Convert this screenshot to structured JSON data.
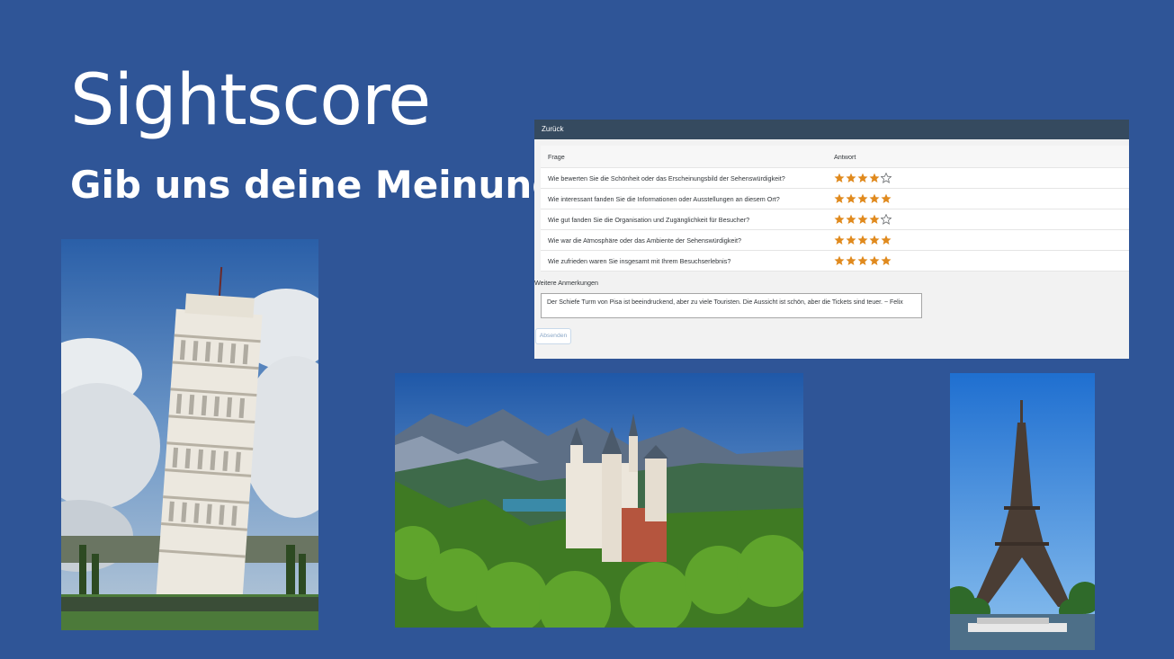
{
  "slide": {
    "title": "Sightscore",
    "subtitle": "Gib uns deine Meinung!"
  },
  "survey": {
    "back_label": "Zurück",
    "columns": {
      "question": "Frage",
      "answer": "Antwort"
    },
    "star_color": "#e08a1e",
    "max_stars": 5,
    "rows": [
      {
        "question": "Wie bewerten Sie die Schönheit oder das Erscheinungsbild der Sehenswürdigkeit?",
        "rating": 4
      },
      {
        "question": "Wie interessant fanden Sie die Informationen oder Ausstellungen an diesem Ort?",
        "rating": 5
      },
      {
        "question": "Wie gut fanden Sie die Organisation und Zugänglichkeit für Besucher?",
        "rating": 4
      },
      {
        "question": "Wie war die Atmosphäre oder das Ambiente der Sehenswürdigkeit?",
        "rating": 5
      },
      {
        "question": "Wie zufrieden waren Sie insgesamt mit Ihrem Besuchserlebnis?",
        "rating": 5
      }
    ],
    "remarks_label": "Weitere Anmerkungen",
    "remarks_value": "Der Schiefe Turm von Pisa ist beeindruckend, aber zu viele Touristen. Die Aussicht ist schön, aber die Tickets sind teuer. ~ Felix",
    "submit_label": "Absenden"
  },
  "photos": [
    {
      "name": "leaning-tower-of-pisa-photo"
    },
    {
      "name": "neuschwanstein-castle-photo"
    },
    {
      "name": "eiffel-tower-photo"
    }
  ]
}
